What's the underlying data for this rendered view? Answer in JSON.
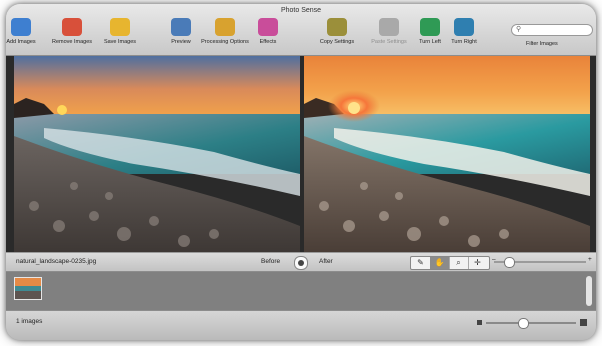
{
  "window": {
    "title": "Photo Sense"
  },
  "toolbar": {
    "buttons": [
      {
        "label": "Add Images",
        "icon": "add-images-icon",
        "color": "#3e7fd0"
      },
      {
        "label": "Remove Images",
        "icon": "remove-images-icon",
        "color": "#d8503a"
      },
      {
        "label": "Save Images",
        "icon": "save-images-icon",
        "color": "#e7b52f"
      },
      {
        "label": "Preview",
        "icon": "preview-icon",
        "color": "#4a7bb8"
      },
      {
        "label": "Processing Options",
        "icon": "processing-options-icon",
        "color": "#d8a22f"
      },
      {
        "label": "Effects",
        "icon": "effects-icon",
        "color": "#c94d9a"
      },
      {
        "label": "Copy Settings",
        "icon": "copy-settings-icon",
        "color": "#9b8f3a"
      },
      {
        "label": "Paste Settings",
        "icon": "paste-settings-icon",
        "color": "#a9a9a9"
      },
      {
        "label": "Turn Left",
        "icon": "turn-left-icon",
        "color": "#2f9a55"
      },
      {
        "label": "Turn Right",
        "icon": "turn-right-icon",
        "color": "#2f7fb0"
      }
    ],
    "search": {
      "placeholder": "",
      "label": "Filter Images"
    }
  },
  "viewer": {
    "filename": "natural_landscape-0235.jpg",
    "before_label": "Before",
    "after_label": "After"
  },
  "tools": [
    {
      "icon": "eyedropper-icon",
      "glyph": "✎"
    },
    {
      "icon": "hand-icon",
      "glyph": "✋"
    },
    {
      "icon": "zoom-icon",
      "glyph": "⌕"
    },
    {
      "icon": "crosshair-icon",
      "glyph": "✛"
    }
  ],
  "zoom": {
    "level": 0.15,
    "min_symbol": "–",
    "max_symbol": "+"
  },
  "status": {
    "count_text": "1 images",
    "thumb_size_level": 0.4
  },
  "colors": {
    "toolbar": "#d6d6d6",
    "strip": "#808080",
    "sunset_sky": "#f28a3a",
    "sea": "#2c7f86"
  }
}
